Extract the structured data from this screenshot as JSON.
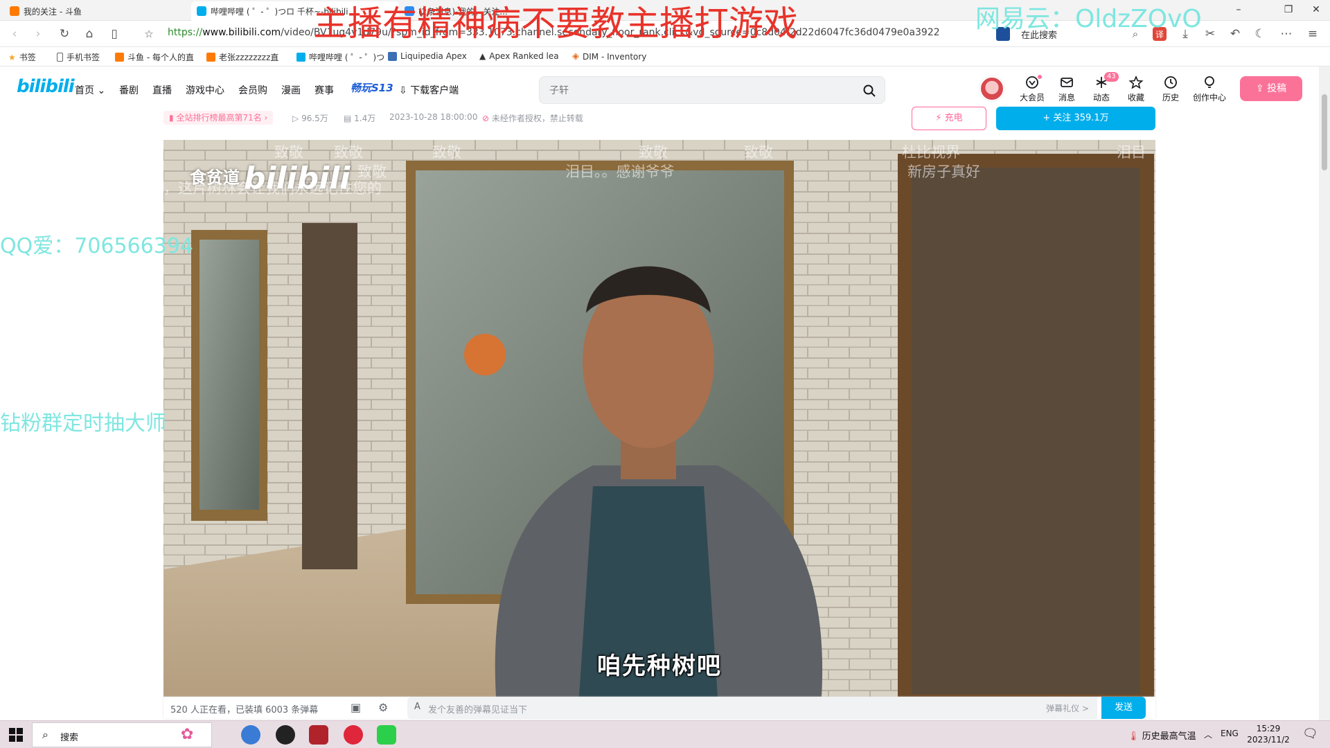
{
  "browser": {
    "tabs": [
      {
        "title": "我的关注 - 斗鱼",
        "active": false
      },
      {
        "title": "哔哩哔哩 ( ゜- ゜)つロ 千杯~-bilibili",
        "active": true
      },
      {
        "title": "(2条消息)-我的，关注..."
      }
    ],
    "url_scheme": "https://",
    "url_host": "www.bilibili.com",
    "url_path": "/video/BV1ug4y1d79u/?spm_id_from=333.1073.channel.secondary_floor_rank.click&vd_source=0c8d04f2d22d6047fc36d0479e0a3922",
    "search_label": "在此搜索",
    "bookmarks": [
      "书签",
      "手机书签",
      "斗鱼 - 每个人的直",
      "老张zzzzzzzz直",
      "哔哩哔哩 ( ゜- ゜)つ",
      "Liquipedia Apex",
      "Apex Ranked lea",
      "DIM - Inventory"
    ]
  },
  "header": {
    "logo": "bilibili",
    "nav": [
      "首页",
      "番剧",
      "直播",
      "游戏中心",
      "会员购",
      "漫画",
      "赛事",
      "畅玩S13",
      "下载客户端"
    ],
    "search_placeholder": "子轩",
    "icons": [
      {
        "label": "大会员",
        "icon": "vip-icon"
      },
      {
        "label": "消息",
        "icon": "message-icon"
      },
      {
        "label": "动态",
        "icon": "dynamic-icon",
        "badge": "43"
      },
      {
        "label": "收藏",
        "icon": "star-icon"
      },
      {
        "label": "历史",
        "icon": "history-icon"
      },
      {
        "label": "创作中心",
        "icon": "bulb-icon"
      }
    ],
    "upload_label": "投稿"
  },
  "video_info": {
    "rank": "全站排行榜最高第71名",
    "views": "96.5万",
    "danmaku_count": "1.4万",
    "date": "2023-10-28 18:00:00",
    "copyright": "未经作者授权，禁止转载",
    "charge": "充电",
    "follow": "+ 关注 359.1万"
  },
  "video": {
    "subtitle": "咱先种树吧",
    "watermark_channel": "食贫道",
    "watermark_logo": "bilibili",
    "danmaku": [
      "致敬",
      "致敬",
      "致敬",
      "致敬",
      "致敬",
      "致敬",
      "泪目。。感谢爷爷",
      "杜比视界",
      "泪目",
      "新房子真好",
      "，这片树林会让我们永远记住您的"
    ]
  },
  "danmaku_bar": {
    "viewers": "520 人正在看，已装填 6003 条弹幕",
    "placeholder": "发个友善的弹幕见证当下",
    "etiquette": "弹幕礼仪 >",
    "send": "发送"
  },
  "overlays": {
    "top_title": "主播有精神病不要教主播打游戏",
    "netease": "网易云：OldzZOvO",
    "qq": "QQ爱：706566394",
    "fans": "钻粉群定时抽大师"
  },
  "taskbar": {
    "search": "搜索",
    "weather": "历史最高气温",
    "lang": "ENG",
    "time": "15:29",
    "date": "2023/11/2"
  }
}
